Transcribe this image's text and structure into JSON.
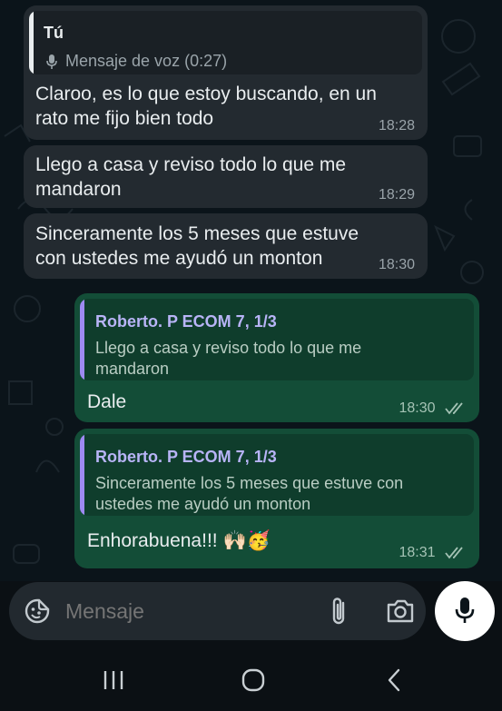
{
  "colors": {
    "background": "#0b141a",
    "incoming_bubble": "#232a30",
    "outgoing_bubble": "#134d37",
    "outgoing_quote": "#0f3d2c",
    "quote_bar_self": "#e9edef",
    "quote_bar_other": "#9e8af2",
    "author_other": "#b8b4f7",
    "read_ticks": "#a5c3b5",
    "composer": "#22292f",
    "mic_button": "#ffffff"
  },
  "messages": {
    "m1": {
      "quote_author": "Tú",
      "quote_icon": "microphone-icon",
      "quote_text": "Mensaje de voz (0:27)",
      "text_line1": "Claroo, es lo que estoy buscando, en un",
      "text_line2": "rato me fijo bien todo",
      "time": "18:28"
    },
    "m2": {
      "text_line1": "Llego a casa y reviso todo lo que me",
      "text_line2": "mandaron",
      "time": "18:29"
    },
    "m3": {
      "text_line1": "Sinceramente los 5 meses que estuve",
      "text_line2": "con ustedes me ayudó un monton",
      "time": "18:30"
    },
    "m4": {
      "quote_author": "Roberto. P ECOM 7, 1/3",
      "quote_line1": "Llego a casa y reviso todo lo que me",
      "quote_line2": "mandaron",
      "text": "Dale",
      "time": "18:30",
      "status_icon": "double-check-icon"
    },
    "m5": {
      "quote_author": "Roberto. P ECOM 7, 1/3",
      "quote_line1": "Sinceramente los 5 meses que estuve con",
      "quote_line2": "ustedes me ayudó un monton",
      "text": "Enhorabuena!!! 🙌🏻🥳",
      "time": "18:31",
      "status_icon": "double-check-icon"
    }
  },
  "composer": {
    "placeholder": "Mensaje",
    "emoji_icon": "sticker-emoji-icon",
    "attach_icon": "paperclip-icon",
    "camera_icon": "camera-icon",
    "send_icon": "microphone-icon"
  },
  "navbar": {
    "recents_icon": "recents-icon",
    "home_icon": "home-icon",
    "back_icon": "back-icon"
  }
}
